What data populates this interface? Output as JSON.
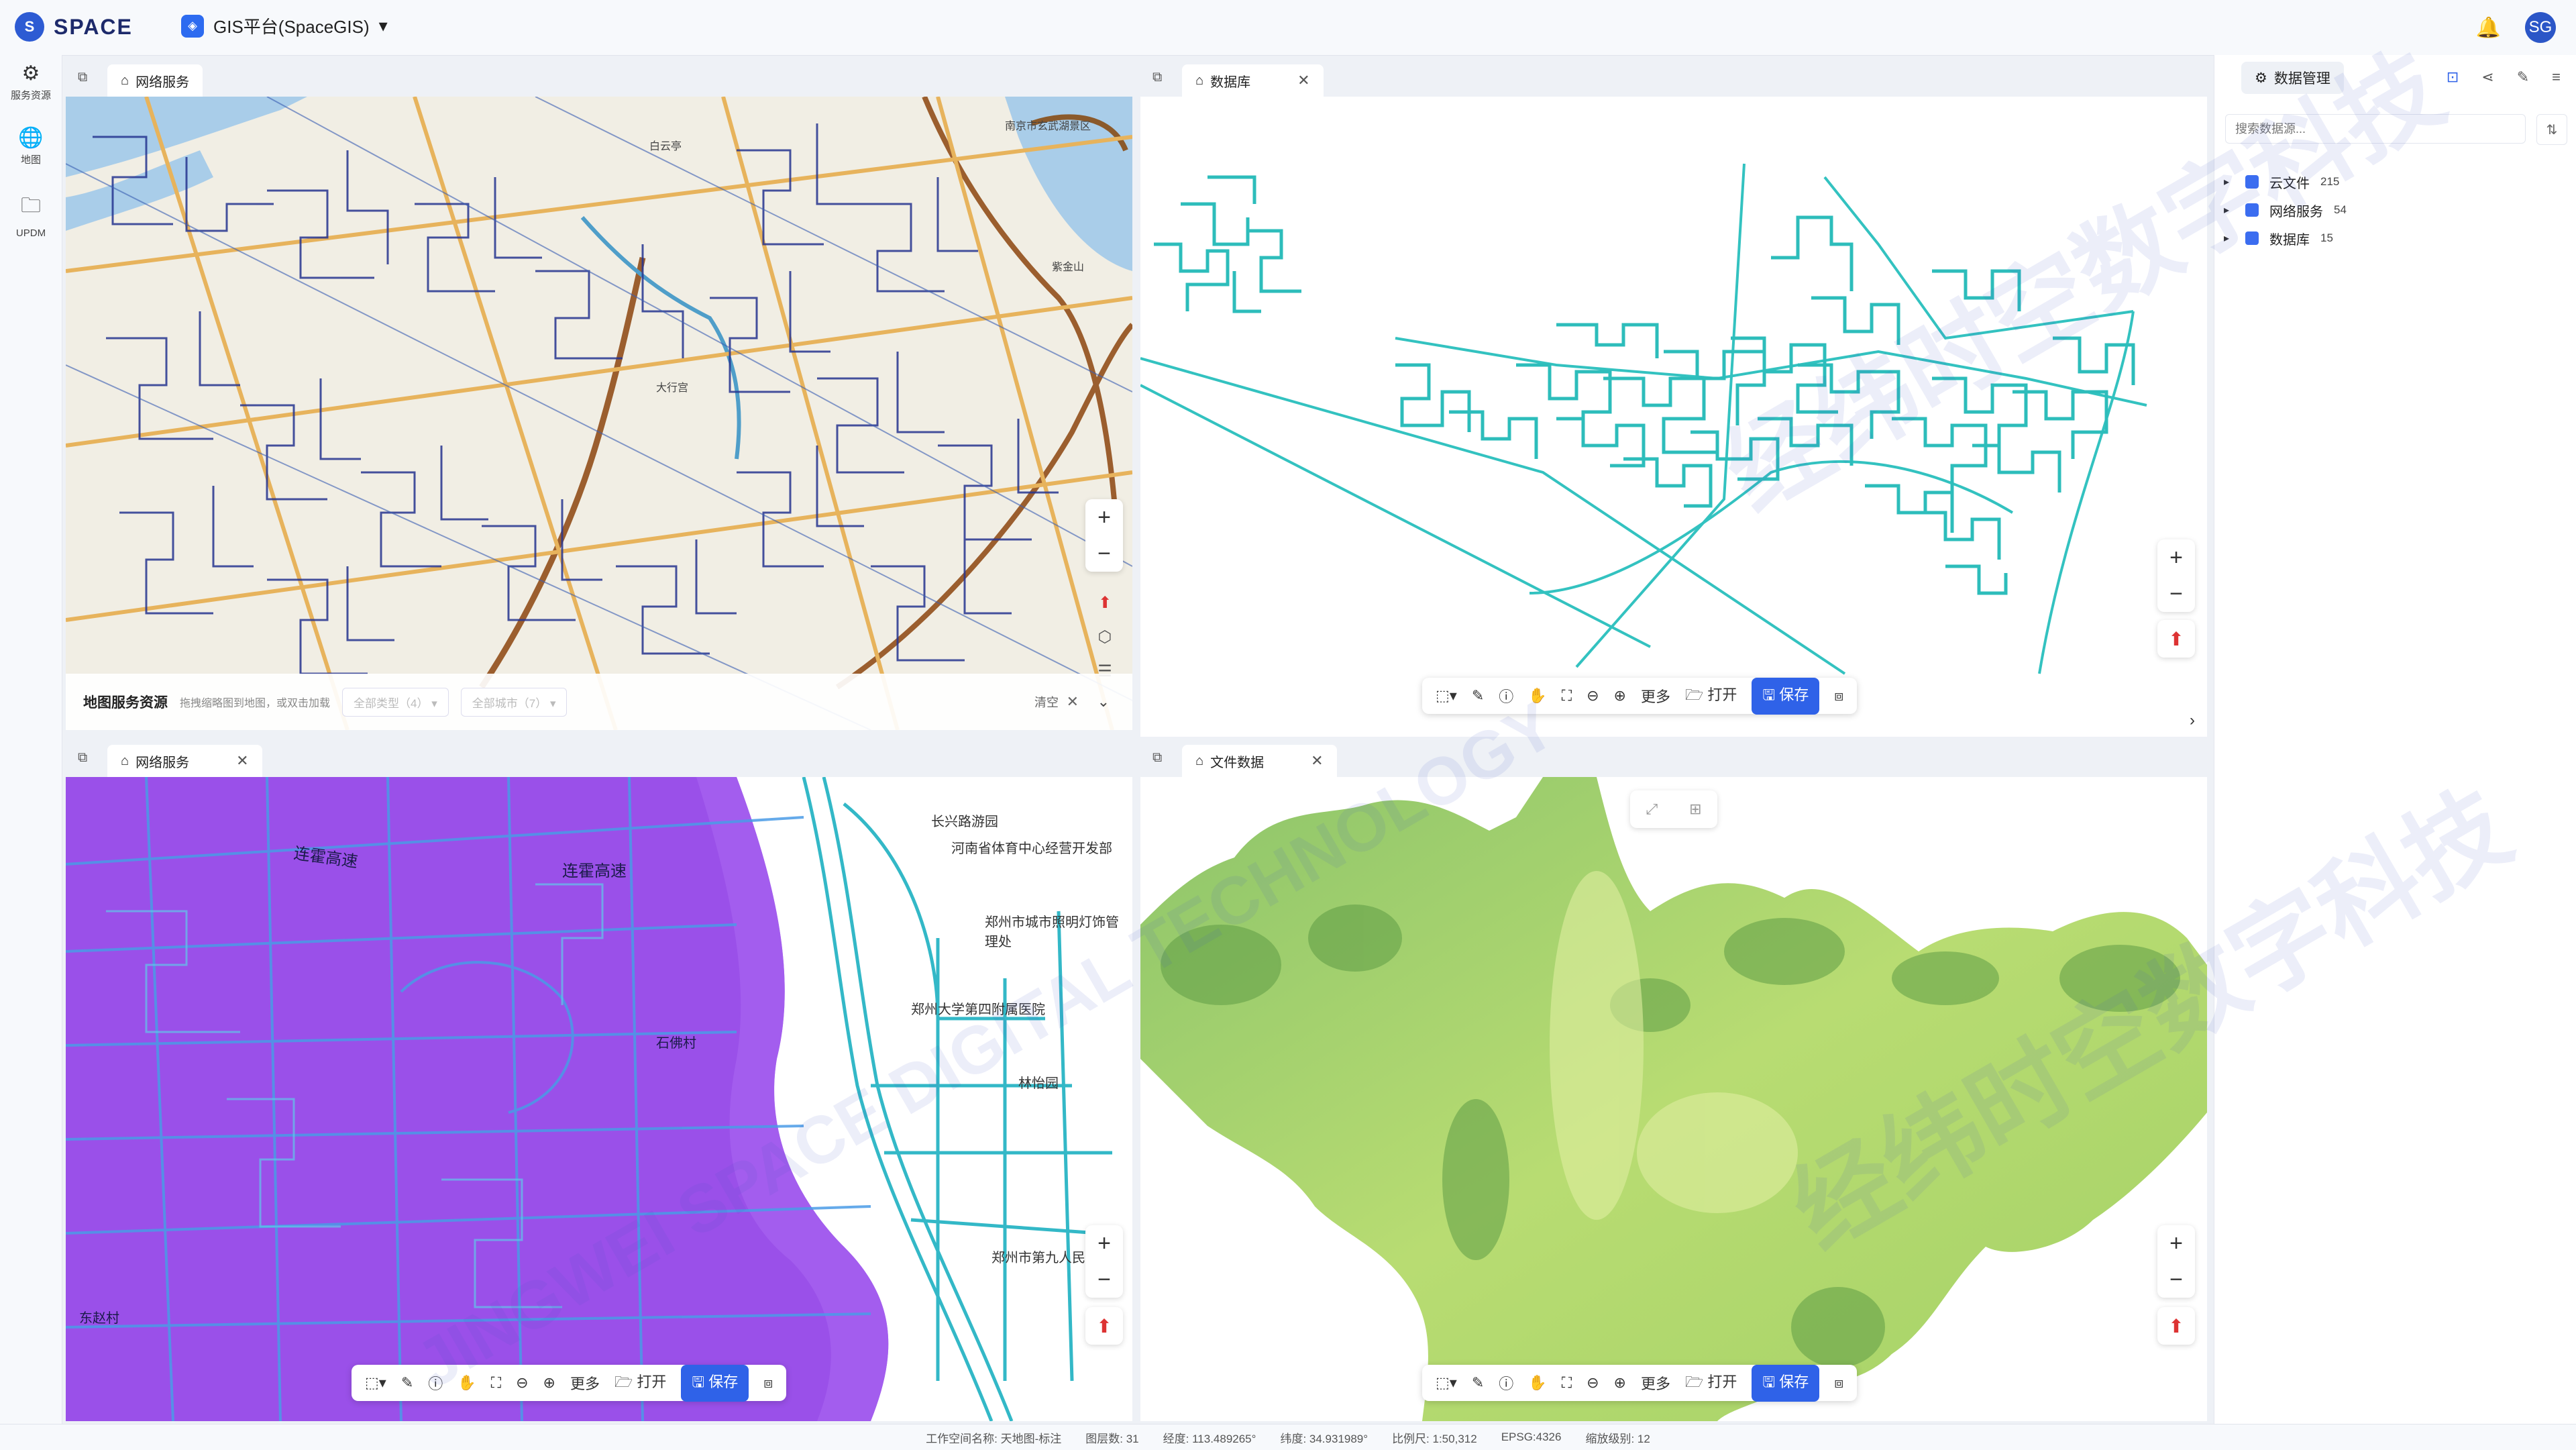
{
  "app": {
    "brand": "SPACE",
    "platform": "GIS平台(SpaceGIS)",
    "avatar": "SG"
  },
  "nav": [
    {
      "label": "服务资源",
      "icon": "gear-icon"
    },
    {
      "label": "地图",
      "icon": "globe-icon"
    },
    {
      "label": "UPDM",
      "icon": "folder-icon"
    }
  ],
  "panels": {
    "tl": {
      "tab": "网络服务"
    },
    "tr": {
      "tab": "数据库"
    },
    "bl": {
      "tab": "网络服务"
    },
    "br": {
      "tab": "文件数据"
    }
  },
  "resource_bar": {
    "title": "地图服务资源",
    "hint": "拖拽缩略图到地图，或双击加载",
    "type_select": "全部类型（4）",
    "city_select": "全部城市（7）",
    "clear": "清空"
  },
  "toolbar": {
    "more": "更多",
    "open": "打开",
    "save": "保存"
  },
  "right_panel": {
    "tab": "数据管理",
    "search_placeholder": "搜索数据源...",
    "tree": [
      {
        "label": "云文件",
        "count": "215"
      },
      {
        "label": "网络服务",
        "count": "54"
      },
      {
        "label": "数据库",
        "count": "15"
      }
    ]
  },
  "map_labels": {
    "tl": [
      "南京市玄武湖景区",
      "白云亭",
      "大行宫",
      "紫金山"
    ],
    "bl": [
      "连霍高速",
      "连霍高速",
      "长兴路游园",
      "河南省体育中心经营开发部",
      "郑州市城市照明灯饰管理处",
      "郑州大学第四附属医院",
      "石佛村",
      "林怡园",
      "郑州市第九人民医院",
      "东赵村"
    ]
  },
  "watermark": [
    "经纬时空数字科技",
    "JINGWEI SPACE DIGITAL TECHNOLOGY"
  ],
  "status_bar": [
    "工作空间名称: 天地图-标注",
    "图层数: 31",
    "经度: 113.489265°",
    "纬度: 34.931989°",
    "比例尺: 1:50,312",
    "EPSG:4326",
    "缩放级别: 12"
  ]
}
